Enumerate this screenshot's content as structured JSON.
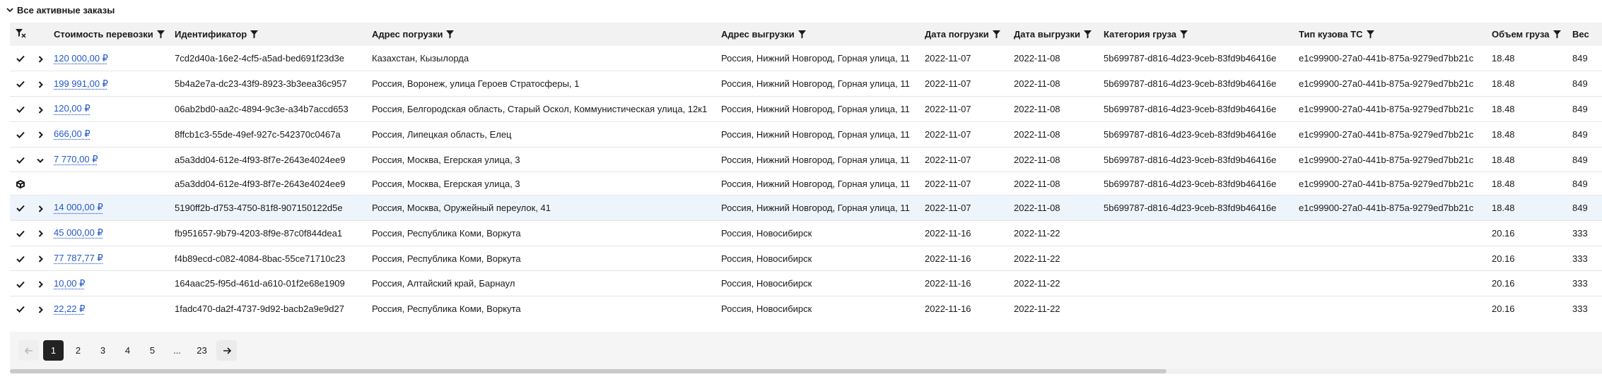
{
  "section": {
    "title": "Все активные заказы"
  },
  "table": {
    "columns": [
      "Стоимость перевозки",
      "Идентификатор",
      "Адрес погрузки",
      "Адрес выгрузки",
      "Дата погрузки",
      "Дата выгрузки",
      "Категория груза",
      "Тип кузова ТС",
      "Объем груза",
      "Вес"
    ],
    "rows": [
      {
        "cost": "120 000,00 ₽",
        "id": "7cd2d40a-16e2-4cf5-a5ad-bed691f23d3e",
        "load": "Казахстан, Кызылорда",
        "unload": "Россия, Нижний Новгород, Горная улица, 11",
        "date_load": "2022-11-07",
        "date_unload": "2022-11-08",
        "category": "5b699787-d816-4d23-9ceb-83fd9b46416e",
        "body": "e1c99900-27a0-441b-875a-9279ed7bb21c",
        "volume": "18.48",
        "weight": "849"
      },
      {
        "cost": "199 991,00 ₽",
        "id": "5b4a2e7a-dc23-43f9-8923-3b3eea36c957",
        "load": "Россия, Воронеж, улица Героев Стратосферы, 1",
        "unload": "Россия, Нижний Новгород, Горная улица, 11",
        "date_load": "2022-11-07",
        "date_unload": "2022-11-08",
        "category": "5b699787-d816-4d23-9ceb-83fd9b46416e",
        "body": "e1c99900-27a0-441b-875a-9279ed7bb21c",
        "volume": "18.48",
        "weight": "849"
      },
      {
        "cost": "120,00 ₽",
        "id": "06ab2bd0-aa2c-4894-9c3e-a34b7accd653",
        "load": "Россия, Белгородская область, Старый Оскол, Коммунистическая улица, 12к1",
        "unload": "Россия, Нижний Новгород, Горная улица, 11",
        "date_load": "2022-11-07",
        "date_unload": "2022-11-08",
        "category": "5b699787-d816-4d23-9ceb-83fd9b46416e",
        "body": "e1c99900-27a0-441b-875a-9279ed7bb21c",
        "volume": "18.48",
        "weight": "849"
      },
      {
        "cost": "666,00 ₽",
        "id": "8ffcb1c3-55de-49ef-927c-542370c0467a",
        "load": "Россия, Липецкая область, Елец",
        "unload": "Россия, Нижний Новгород, Горная улица, 11",
        "date_load": "2022-11-07",
        "date_unload": "2022-11-08",
        "category": "5b699787-d816-4d23-9ceb-83fd9b46416e",
        "body": "e1c99900-27a0-441b-875a-9279ed7bb21c",
        "volume": "18.48",
        "weight": "849"
      },
      {
        "cost": "7 770,00 ₽",
        "id": "a5a3dd04-612e-4f93-8f7e-2643e4024ee9",
        "load": "Россия, Москва, Егерская улица, 3",
        "unload": "Россия, Нижний Новгород, Горная улица, 11",
        "date_load": "2022-11-07",
        "date_unload": "2022-11-08",
        "category": "5b699787-d816-4d23-9ceb-83fd9b46416e",
        "body": "e1c99900-27a0-441b-875a-9279ed7bb21c",
        "volume": "18.48",
        "weight": "849",
        "expanded": true
      },
      {
        "child": true,
        "cost": "",
        "id": "a5a3dd04-612e-4f93-8f7e-2643e4024ee9",
        "load": "Россия, Москва, Егерская улица, 3",
        "unload": "Россия, Нижний Новгород, Горная улица, 11",
        "date_load": "2022-11-07",
        "date_unload": "2022-11-08",
        "category": "5b699787-d816-4d23-9ceb-83fd9b46416e",
        "body": "e1c99900-27a0-441b-875a-9279ed7bb21c",
        "volume": "18.48",
        "weight": "849"
      },
      {
        "cost": "14 000,00 ₽",
        "id": "5190ff2b-d753-4750-81f8-907150122d5e",
        "load": "Россия, Москва, Оружейный переулок, 41",
        "unload": "Россия, Нижний Новгород, Горная улица, 11",
        "date_load": "2022-11-07",
        "date_unload": "2022-11-08",
        "category": "5b699787-d816-4d23-9ceb-83fd9b46416e",
        "body": "e1c99900-27a0-441b-875a-9279ed7bb21c",
        "volume": "18.48",
        "weight": "849",
        "selected": true
      },
      {
        "cost": "45 000,00 ₽",
        "id": "fb951657-9b79-4203-8f9e-87c0f844dea1",
        "load": "Россия, Республика Коми, Воркута",
        "unload": "Россия, Новосибирск",
        "date_load": "2022-11-16",
        "date_unload": "2022-11-22",
        "category": "",
        "body": "",
        "volume": "20.16",
        "weight": "333"
      },
      {
        "cost": "77 787,77 ₽",
        "id": "f4b89ecd-c082-4084-8bac-55ce71710c23",
        "load": "Россия, Республика Коми, Воркута",
        "unload": "Россия, Новосибирск",
        "date_load": "2022-11-16",
        "date_unload": "2022-11-22",
        "category": "",
        "body": "",
        "volume": "20.16",
        "weight": "333"
      },
      {
        "cost": "10,00 ₽",
        "id": "164aac25-f95d-461d-a610-01f2e68e1909",
        "load": "Россия, Алтайский край, Барнаул",
        "unload": "Россия, Новосибирск",
        "date_load": "2022-11-16",
        "date_unload": "2022-11-22",
        "category": "",
        "body": "",
        "volume": "20.16",
        "weight": "333"
      },
      {
        "cost": "22,22 ₽",
        "id": "1fadc470-da2f-4737-9d92-bacb2a9e9d27",
        "load": "Россия, Республика Коми, Воркута",
        "unload": "Россия, Новосибирск",
        "date_load": "2022-11-16",
        "date_unload": "2022-11-22",
        "category": "",
        "body": "",
        "volume": "20.16",
        "weight": "333"
      }
    ]
  },
  "pagination": {
    "pages": [
      "1",
      "2",
      "3",
      "4",
      "5",
      "...",
      "23"
    ],
    "current": "1"
  },
  "icons": {
    "header_toggle": "chevron-down-icon",
    "filter": "filter-icon",
    "clear_filter": "filter-clear-icon",
    "row_check": "check-icon",
    "row_expand": "chevron-right-icon",
    "row_collapse": "chevron-down-icon",
    "child_row": "box-icon",
    "prev": "arrow-left-icon",
    "next": "arrow-right-icon"
  },
  "colors": {
    "link": "#2357c9",
    "header_bg": "#f2f2f2",
    "selected_row": "#eef4fb",
    "active_page": "#222222"
  }
}
